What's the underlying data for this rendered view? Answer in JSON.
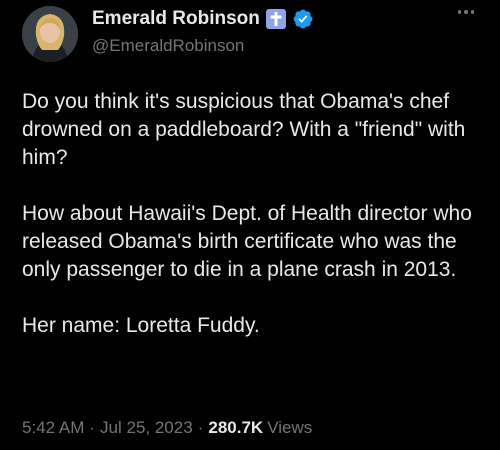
{
  "tweet": {
    "author": {
      "display_name": "Emerald Robinson",
      "handle": "@EmeraldRobinson",
      "badges": [
        "cross-icon",
        "verified-badge-icon"
      ]
    },
    "paragraphs": [
      "Do you think it's suspicious that Obama's chef drowned on a paddleboard? With a \"friend\" with him?",
      "How about Hawaii's Dept. of Health director who released Obama's birth certificate who was the only passenger to die in a plane crash in 2013.",
      "Her name: Loretta Fuddy."
    ],
    "meta": {
      "time": "5:42 AM",
      "separator": "·",
      "date": "Jul 25, 2023",
      "views_count": "280.7K",
      "views_label": "Views"
    }
  },
  "colors": {
    "background": "#000000",
    "text": "#e7e9ea",
    "muted": "#71767b",
    "verified": "#1d9bf0",
    "cross_badge": "#8ea3e8"
  }
}
